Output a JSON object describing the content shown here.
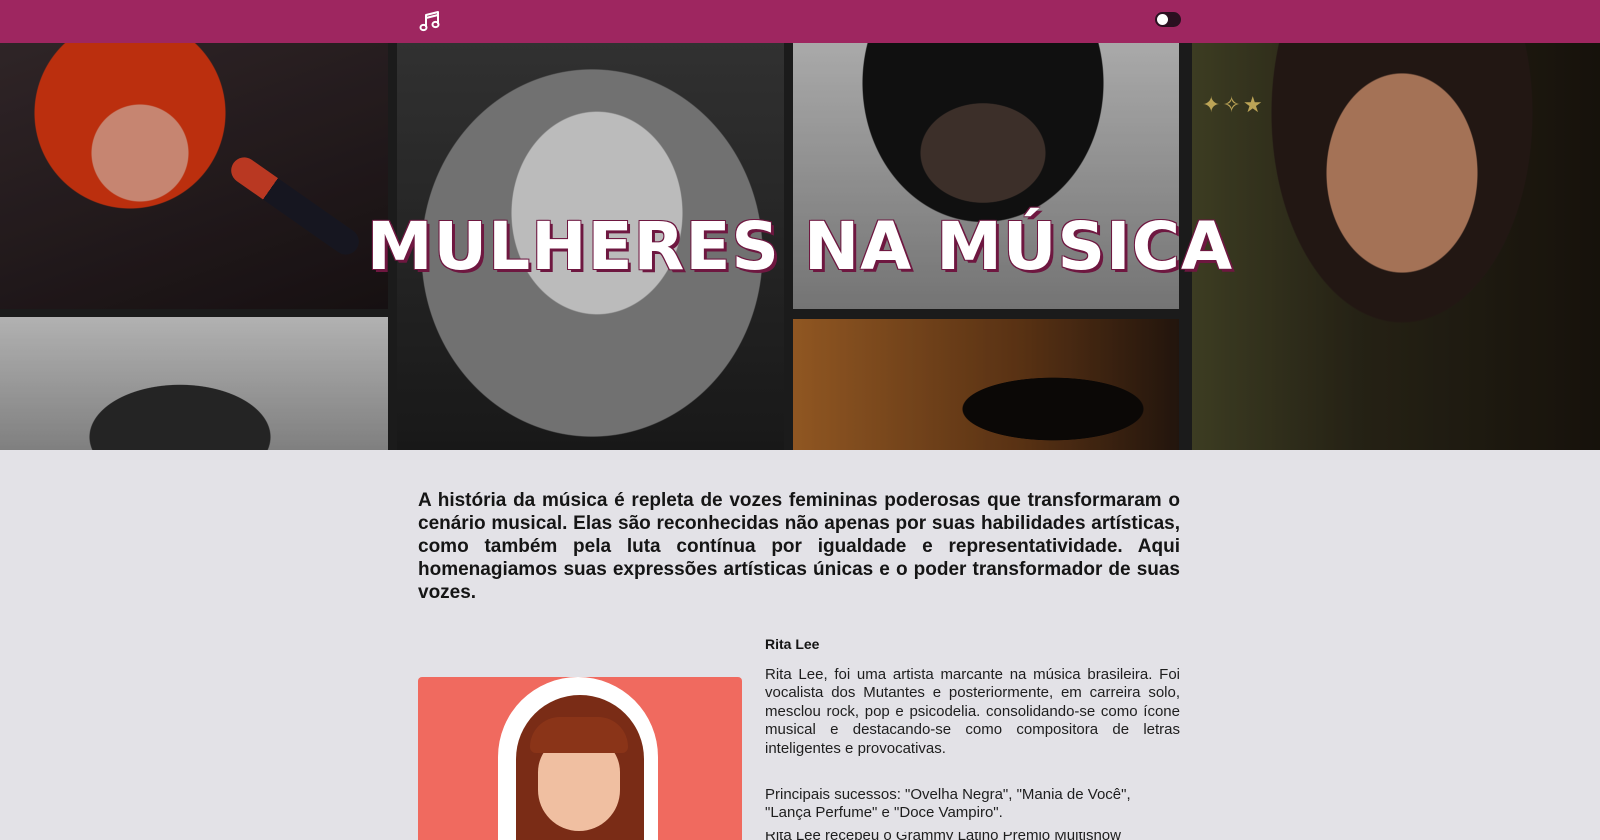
{
  "header": {
    "logo_icon": "music-note-icon",
    "theme_toggle_icon": "toggle-switch-icon",
    "bar_color": "#9e2660"
  },
  "hero": {
    "title": "MULHERES NA MÚSICA"
  },
  "intro": {
    "text": "A história da música é repleta de vozes femininas poderosas que transformaram o cenário musical. Elas são reconhecidas não apenas por suas habilidades artísticas, como também pela luta contínua por igualdade e representatividade. Aqui homenagiamos suas expressões artísticas únicas e o poder transformador de suas vozes."
  },
  "artist": {
    "name": "Rita Lee",
    "bio": "Rita Lee, foi uma artista marcante na música brasileira. Foi vocalista dos Mutantes e posteriormente, em carreira solo, mesclou rock, pop e psicodelia. consolidando-se como ícone musical e destacando-se como compositora de letras inteligentes e provocativas.",
    "hits": "Principais sucessos: \"Ovelha Negra\", \"Mania de Você\", \"Lança Perfume\" e \"Doce Vampiro\".",
    "more": "Rita Lee recebeu o Grammy Latino Prêmio Multishow",
    "card_color": "#f06a5f"
  }
}
